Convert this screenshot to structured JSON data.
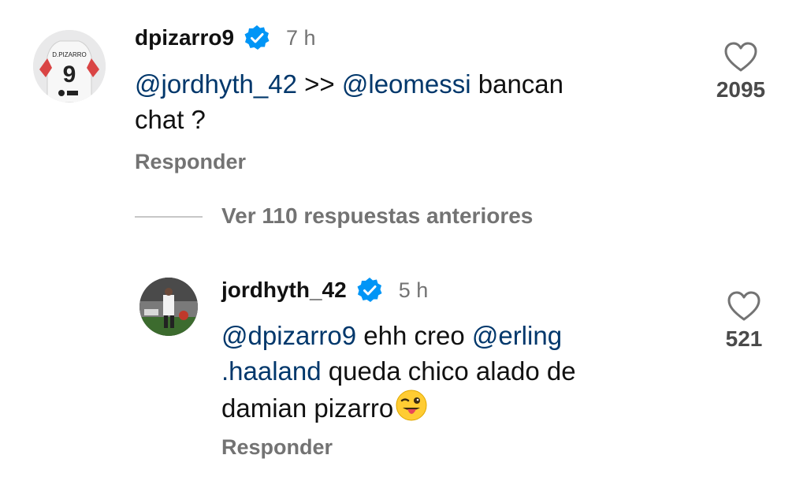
{
  "comment1": {
    "username": "dpizarro9",
    "time": "7 h",
    "mention1": "@jordhyth_42",
    "sep": " >> ",
    "mention2": "@leomessi",
    "text_line1_rest": " bancan",
    "text_line2": "chat ?",
    "like_count": "2095",
    "reply_label": "Responder",
    "avatar_jersey_name": "D.PIZARRO",
    "avatar_jersey_number": "9"
  },
  "view_replies": "Ver 110 respuestas anteriores",
  "comment2": {
    "username": "jordhyth_42",
    "time": "5 h",
    "mention1": "@dpizarro9",
    "text_after_mention1": " ehh creo ",
    "mention2_line1": "@erling",
    "mention2_line2": ".haaland",
    "text_line2_rest": " queda chico alado de",
    "text_line3": "damian pizarro",
    "emoji": "winking-face-with-tongue",
    "like_count": "521",
    "reply_label": "Responder"
  },
  "colors": {
    "mention": "#00376b",
    "verified": "#0095f6",
    "secondary_text": "#737373"
  }
}
